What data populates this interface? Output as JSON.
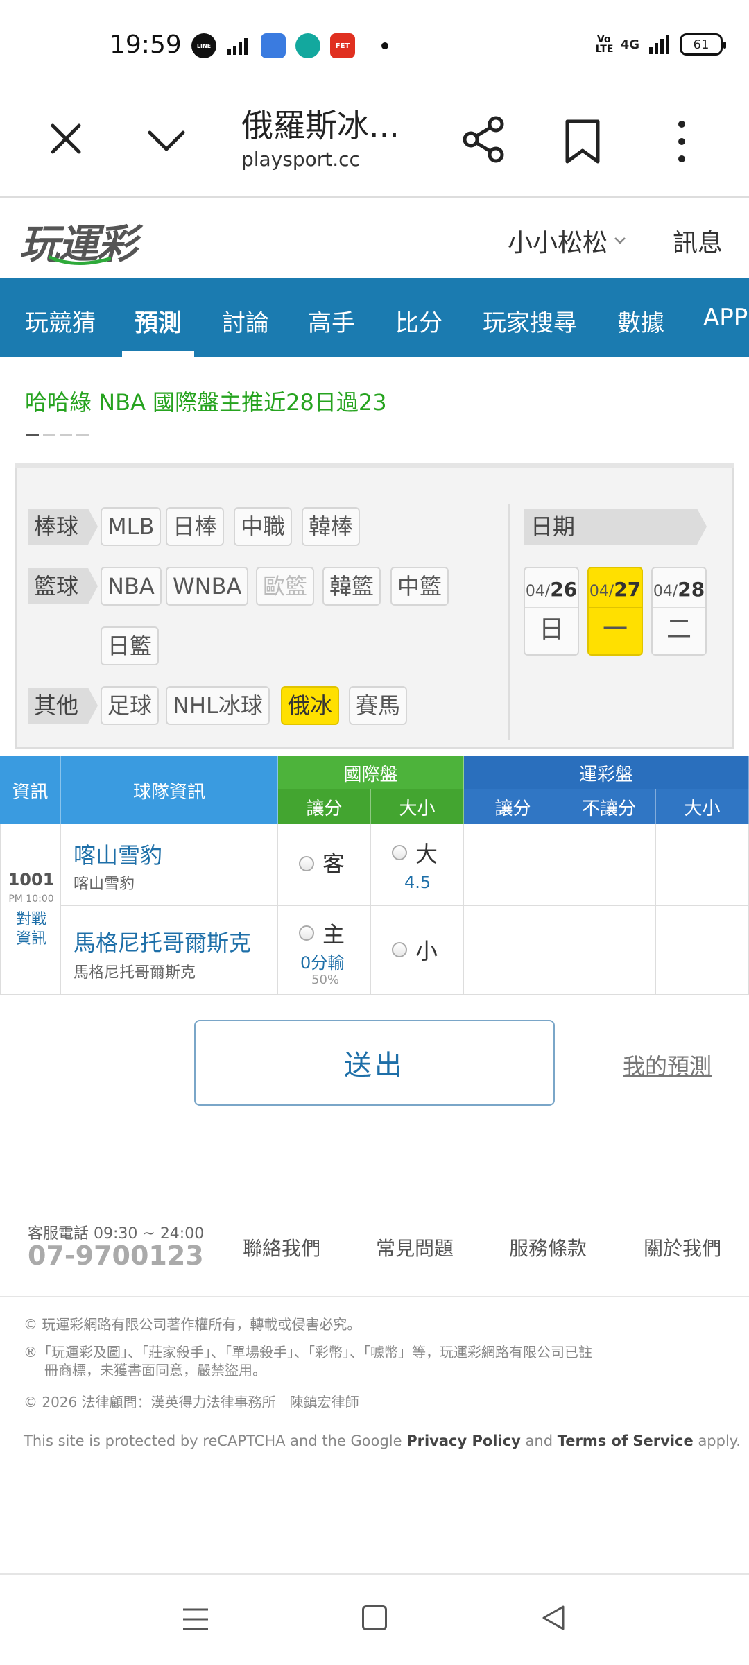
{
  "status_bar": {
    "time": "19:59",
    "apps": [
      {
        "icon": "line-app-icon",
        "color": "#111111",
        "label": "LINE"
      },
      {
        "icon": "signal-bars-app-icon",
        "color": "#111111",
        "label": ""
      },
      {
        "icon": "blue-app-icon",
        "color": "#3a7be0",
        "label": ""
      },
      {
        "icon": "teal-app-icon",
        "color": "#13a89e",
        "label": ""
      },
      {
        "icon": "fet-app-icon",
        "color": "#e03020",
        "label": "FET"
      }
    ],
    "volte": "Vo LTE",
    "network": "4G",
    "battery": "61"
  },
  "browser": {
    "title": "俄羅斯冰...",
    "url": "playsport.cc"
  },
  "site": {
    "logo": "玩運彩",
    "user": "小小松松",
    "messages": "訊息"
  },
  "nav": {
    "items": [
      "玩競猜",
      "預測",
      "討論",
      "高手",
      "比分",
      "玩家搜尋",
      "數據",
      "APP"
    ],
    "active": "預測"
  },
  "banner": {
    "text": "哈哈綠 NBA 國際盤主推近28日過23"
  },
  "filters": {
    "baseball": {
      "label": "棒球",
      "items": [
        "MLB",
        "日棒",
        "中職",
        "韓棒"
      ]
    },
    "basketball": {
      "label": "籃球",
      "items": [
        "NBA",
        "WNBA",
        "歐籃",
        "韓籃",
        "中籃",
        "日籃"
      ]
    },
    "other": {
      "label": "其他",
      "items": [
        "足球",
        "NHL冰球",
        "俄冰",
        "賽馬"
      ]
    },
    "date_label": "日期",
    "dates": [
      {
        "month": "04/",
        "day": "26",
        "weekday": "日"
      },
      {
        "month": "04/",
        "day": "27",
        "weekday": "一"
      },
      {
        "month": "04/",
        "day": "28",
        "weekday": "二"
      }
    ],
    "active_date": "04/27",
    "active_league": "俄冰"
  },
  "table": {
    "headers": {
      "info": "資訊",
      "team_info": "球隊資訊",
      "intl": "國際盤",
      "intl_spread": "讓分",
      "intl_total": "大小",
      "sports_lottery": "運彩盤",
      "sl_spread": "讓分",
      "sl_moneyline": "不讓分",
      "sl_total": "大小"
    },
    "game": {
      "number": "1001",
      "time": "PM 10:00",
      "matchup_link": "對戰資訊",
      "away": {
        "name": "喀山雪豹",
        "sub": "喀山雪豹",
        "spread_label": "客",
        "total_label": "大",
        "total_value": "4.5"
      },
      "home": {
        "name": "馬格尼托哥爾斯克",
        "sub": "馬格尼托哥爾斯克",
        "spread_label": "主",
        "spread_value": "0分輸",
        "spread_pct": "50%",
        "total_label": "小"
      }
    }
  },
  "actions": {
    "submit": "送出",
    "my_predictions": "我的預測"
  },
  "footer": {
    "phone_label": "客服電話 09:30 ~ 24:00",
    "phone": "07-9700123",
    "links": [
      "聯絡我們",
      "常見問題",
      "服務條款",
      "關於我們"
    ],
    "copyright": "© 玩運彩網路有限公司著作權所有，轉載或侵害必究。",
    "trademark_1": "®「玩運彩及圖」、「莊家殺手」、「單場殺手」、「彩幣」、「噱幣」等，玩運彩網路有限公司已註",
    "trademark_2": "冊商標，未獲書面同意，嚴禁盜用。",
    "legal": "© 2026 法律顧問：漢英得力法律事務所　陳鎮宏律師",
    "captcha_pre": "This site is protected by reCAPTCHA and the Google",
    "privacy": "Privacy Policy",
    "and": "and",
    "terms": "Terms of Service",
    "apply": "apply."
  }
}
